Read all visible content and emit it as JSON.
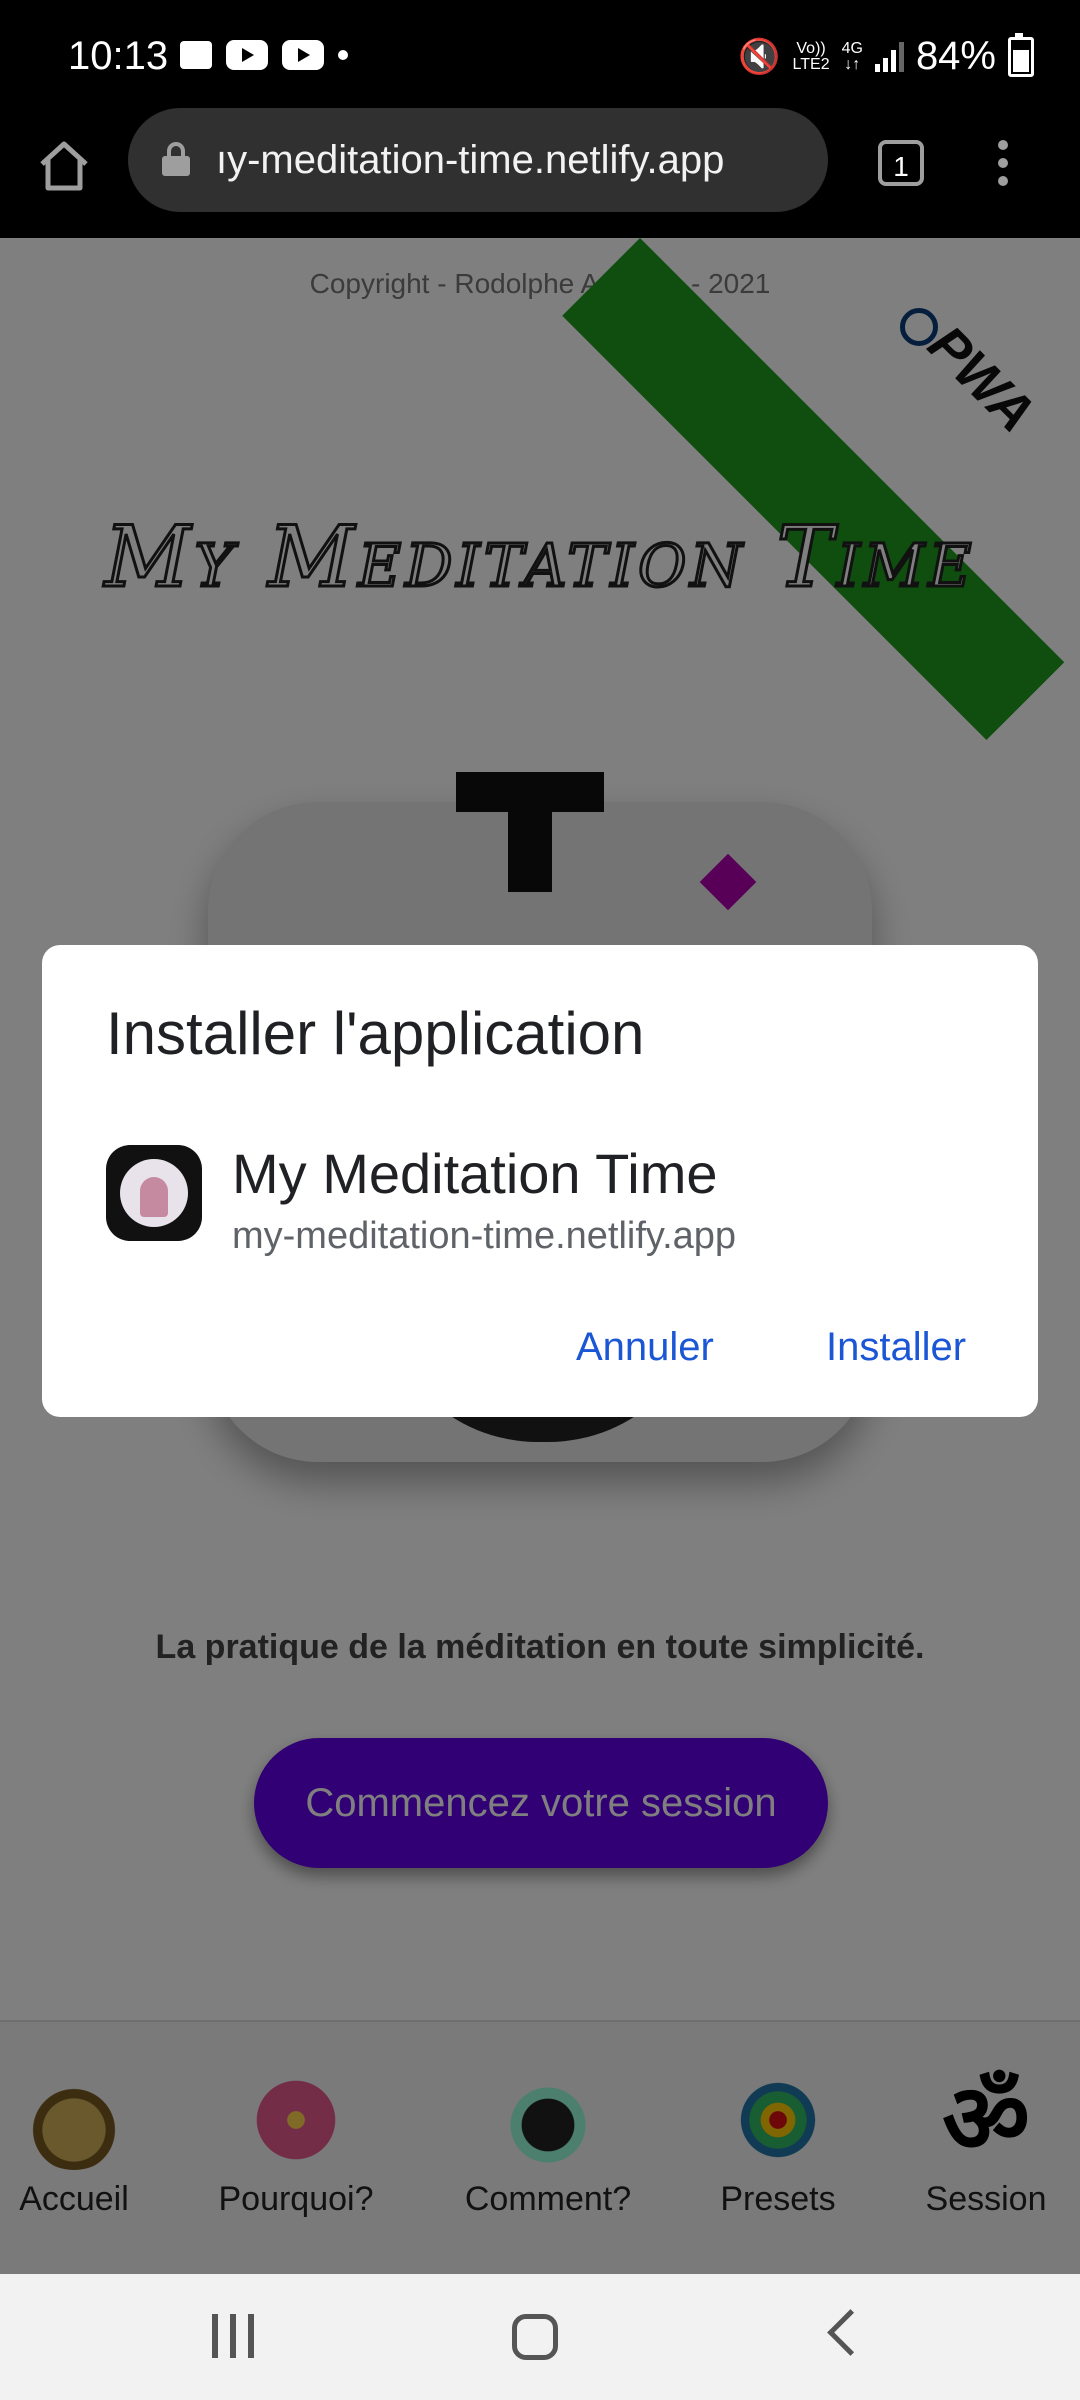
{
  "status_bar": {
    "time": "10:13",
    "network_top": "Vo))",
    "network_bottom": "LTE2",
    "data_top": "4G",
    "battery": "84%",
    "battery_level": 0.84
  },
  "browser": {
    "url": "ıy-meditation-time.netlify.app",
    "tab_count": "1"
  },
  "page": {
    "copyright": "Copyright - Rodolphe Augusto - 2021",
    "ribbon": "PWA",
    "title": "My Meditation Time",
    "tagline": "La pratique de la méditation en toute simplicité.",
    "cta": "Commencez votre session"
  },
  "app_nav": {
    "items": [
      {
        "label": "Accueil",
        "icon": "lotus-icon"
      },
      {
        "label": "Pourquoi?",
        "icon": "flower-icon"
      },
      {
        "label": "Comment?",
        "icon": "yin-yang-icon"
      },
      {
        "label": "Presets",
        "icon": "mandala-icon"
      },
      {
        "label": "Session",
        "icon": "om-icon",
        "glyph": "ॐ"
      }
    ]
  },
  "dialog": {
    "title": "Installer l'application",
    "app_name": "My Meditation Time",
    "app_url": "my-meditation-time.netlify.app",
    "cancel": "Annuler",
    "install": "Installer"
  },
  "colors": {
    "accent_blue": "#1a56d6",
    "cta_purple": "#6200ea",
    "ribbon_green": "#1f9c1f"
  }
}
